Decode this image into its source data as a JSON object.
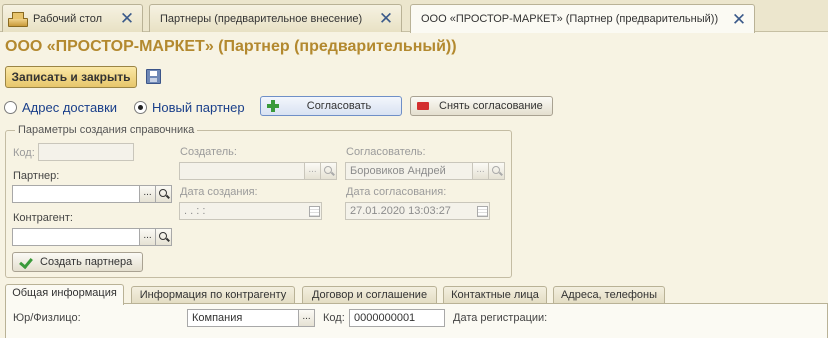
{
  "window_tabs": [
    {
      "label": "Рабочий стол"
    },
    {
      "label": "Партнеры (предварительное внесение)"
    },
    {
      "label": "ООО «ПРОСТОР-МАРКЕТ» (Партнер (предварительный))"
    }
  ],
  "page_title": "ООО «ПРОСТОР-МАРКЕТ» (Партнер (предварительный))",
  "toolbar": {
    "save_close_label": "Записать и закрыть"
  },
  "radio": {
    "delivery_address": "Адрес доставки",
    "new_partner": "Новый партнер",
    "selected": "new_partner"
  },
  "actions": {
    "agree_label": "Согласовать",
    "revoke_label": "Снять согласование"
  },
  "params": {
    "group_title": "Параметры создания справочника",
    "code_label": "Код:",
    "code_value": "",
    "partner_label": "Партнер:",
    "partner_value": "",
    "counterparty_label": "Контрагент:",
    "counterparty_value": "",
    "creator_label": "Создатель:",
    "creator_value": "",
    "approver_label": "Согласователь:",
    "approver_value": "Боровиков Андрей",
    "created_date_label": "Дата создания:",
    "created_date_value": ". .   : :",
    "approval_date_label": "Дата согласования:",
    "approval_date_value": "27.01.2020 13:03:27",
    "create_partner_label": "Создать партнера",
    "choice_glyph": "..."
  },
  "bottom_tabs": [
    {
      "label": "Общая информация"
    },
    {
      "label": "Информация по контрагенту"
    },
    {
      "label": "Договор и соглашение"
    },
    {
      "label": "Контактные лица"
    },
    {
      "label": "Адреса, телефоны"
    }
  ],
  "general": {
    "legal_type_label": "Юр/Физлицо:",
    "legal_type_value": "Компания",
    "code_label": "Код:",
    "code_value": "0000000001",
    "reg_date_label": "Дата регистрации:"
  },
  "colors": {
    "title": "#b3892f",
    "accent_button": "#e7c66b",
    "radio_text": "#1a3f8a"
  }
}
